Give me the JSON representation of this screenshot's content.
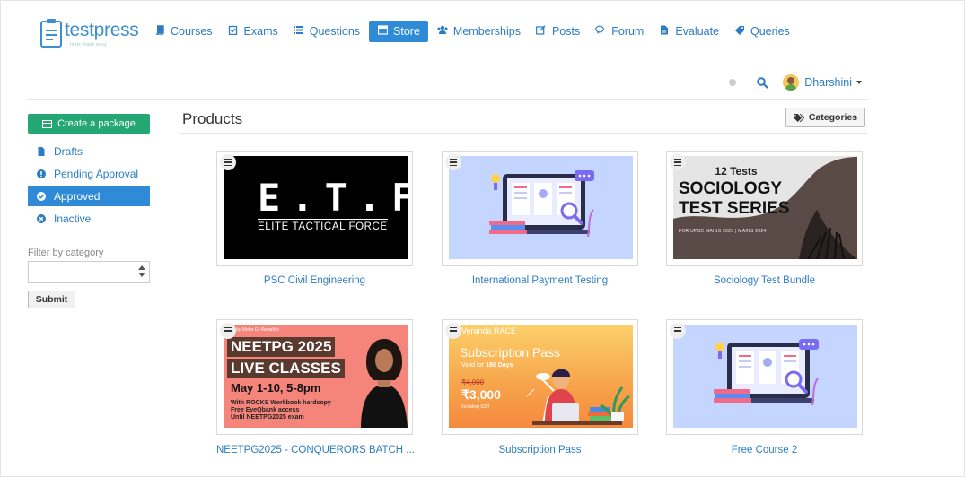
{
  "logo": {
    "name": "testpress",
    "tagline": "tests made easy"
  },
  "nav": [
    {
      "label": "Courses",
      "icon": "book-icon",
      "active": false
    },
    {
      "label": "Exams",
      "icon": "clipboard-check-icon",
      "active": false
    },
    {
      "label": "Questions",
      "icon": "list-icon",
      "active": false
    },
    {
      "label": "Store",
      "icon": "store-icon",
      "active": true
    },
    {
      "label": "Memberships",
      "icon": "users-icon",
      "active": false
    },
    {
      "label": "Posts",
      "icon": "edit-icon",
      "active": false
    },
    {
      "label": "Forum",
      "icon": "comments-icon",
      "active": false
    },
    {
      "label": "Evaluate",
      "icon": "file-icon",
      "active": false
    },
    {
      "label": "Queries",
      "icon": "tag-icon",
      "active": false
    }
  ],
  "user": {
    "name": "Dharshini"
  },
  "sidebar": {
    "create_label": "Create a package",
    "items": [
      {
        "label": "Drafts",
        "icon": "file-icon",
        "active": false
      },
      {
        "label": "Pending Approval",
        "icon": "exclamation-circle-icon",
        "active": false
      },
      {
        "label": "Approved",
        "icon": "check-circle-icon",
        "active": true
      },
      {
        "label": "Inactive",
        "icon": "times-circle-icon",
        "active": false
      }
    ],
    "filter_label": "Filter by category",
    "filter_value": "",
    "submit_label": "Submit"
  },
  "main": {
    "title": "Products",
    "categories_label": "Categories",
    "products": [
      {
        "title": "PSC Civil Engineering",
        "thumb": {
          "big": "E.T.F",
          "sub": "ELITE TACTICAL FORCE"
        }
      },
      {
        "title": "International Payment Testing",
        "thumb": {}
      },
      {
        "title": "Sociology Test Bundle",
        "thumb": {
          "tests": "12 Tests",
          "line1": "SOCIOLOGY",
          "line2": "TEST SERIES",
          "foot": "FOR UPSC MAINS 2023 | MAINS 2024"
        }
      },
      {
        "title": "NEETPG2025 - CONQUERORS BATCH ...",
        "thumb": {
          "dr": "by Motor Dr Revathi's",
          "line1": "NEETPG 2025",
          "line2": "LIVE CLASSES",
          "dates": "May 1-10, 5-8pm",
          "note1": "With ROCKS Workbook hardcopy",
          "note2": "Free EyeQbank access",
          "note3": "Until NEETPG2025 exam"
        }
      },
      {
        "title": "Subscription Pass",
        "thumb": {
          "brand": "Veranda RACE",
          "head": "Subscription Pass",
          "valid_prefix": "Valid for ",
          "valid_bold": "180 Days",
          "old": "₹4,000",
          "price": "₹3,000",
          "gst": "Including GST"
        }
      },
      {
        "title": "Free Course 2",
        "thumb": {}
      }
    ]
  }
}
